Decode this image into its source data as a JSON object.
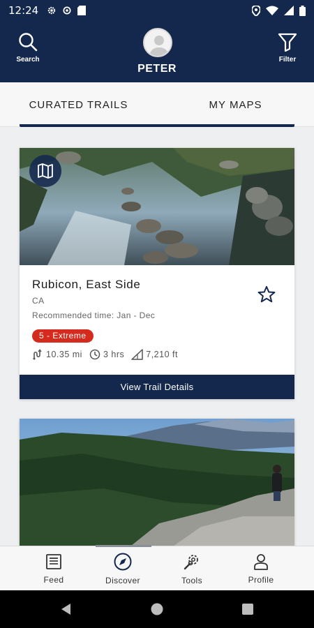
{
  "status_bar": {
    "time": "12:24"
  },
  "header": {
    "search_label": "Search",
    "username": "PETER",
    "filter_label": "Filter"
  },
  "tabs": [
    {
      "label": "CURATED TRAILS",
      "active": true
    },
    {
      "label": "MY MAPS",
      "active": false
    }
  ],
  "trails": [
    {
      "title": "Rubicon, East Side",
      "state": "CA",
      "recommended": "Recommended time: Jan - Dec",
      "difficulty": "5 - Extreme",
      "difficulty_color": "#d52b1e",
      "distance": "10.35 mi",
      "duration": "3 hrs",
      "elevation": "7,210 ft",
      "button": "View Trail Details",
      "favorited": false
    }
  ],
  "bottom_nav": [
    {
      "label": "Feed",
      "icon": "newspaper-icon",
      "active": false
    },
    {
      "label": "Discover",
      "icon": "compass-icon",
      "active": true
    },
    {
      "label": "Tools",
      "icon": "wrench-gear-icon",
      "active": false
    },
    {
      "label": "Profile",
      "icon": "person-icon",
      "active": false
    }
  ],
  "colors": {
    "primary": "#14284d",
    "badge_red": "#d52b1e",
    "background": "#eeeff1"
  }
}
